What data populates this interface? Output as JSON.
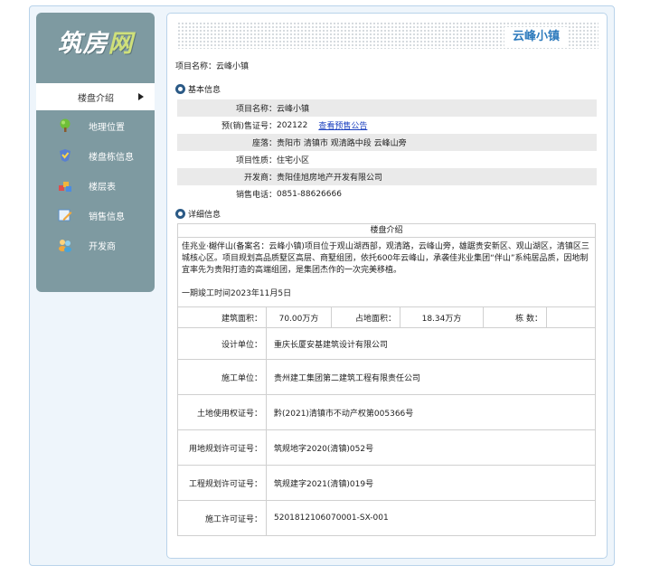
{
  "sidebar": {
    "logo": {
      "part1": "筑房",
      "part2": "网"
    },
    "active_item": "楼盘介绍",
    "items": [
      {
        "label": "地理位置",
        "icon": "tree-icon"
      },
      {
        "label": "楼盘栋信息",
        "icon": "badge-icon"
      },
      {
        "label": "楼层表",
        "icon": "blocks-icon"
      },
      {
        "label": "销售信息",
        "icon": "pencil-icon"
      },
      {
        "label": "开发商",
        "icon": "people-icon"
      }
    ]
  },
  "banner": {
    "title": "云峰小镇"
  },
  "project_name_line": "项目名称：云峰小镇",
  "basic": {
    "heading": "基本信息",
    "rows": [
      {
        "key": "项目名称：",
        "value": "云峰小镇"
      },
      {
        "key": "预(销)售证号：",
        "value": "202122",
        "link": "查看预售公告"
      },
      {
        "key": "座落：",
        "value": "贵阳市 清镇市 观清路中段 云峰山旁"
      },
      {
        "key": "项目性质：",
        "value": "住宅小区"
      },
      {
        "key": "开发商：",
        "value": "贵阳佳旭房地产开发有限公司"
      },
      {
        "key": "销售电话：",
        "value": "0851-88626666"
      }
    ]
  },
  "detail": {
    "heading": "详细信息",
    "table_title": "楼盘介绍",
    "description": "佳兆业·樾伴山(备案名：云峰小镇)项目位于观山湖西部，观清路，云峰山旁，雄踞贵安新区、观山湖区，清镇区三城核心区。项目规划高品质墅区高层、商墅组团，依托600年云峰山，承袭佳兆业集团“伴山”系纯居品质，因地制宜率先为贵阳打造的高端组团，是集团杰作的一次完美移植。",
    "completion": "一期竣工时间2023年11月5日",
    "area": {
      "build_label": "建筑面积：",
      "build_value": "70.00万方",
      "land_label": "占地面积：",
      "land_value": "18.34万方",
      "count_label": "栋 数：",
      "count_value": ""
    },
    "rows": [
      {
        "key": "设计单位：",
        "value": "重庆长厦安基建筑设计有限公司"
      },
      {
        "key": "施工单位：",
        "value": "贵州建工集团第二建筑工程有限责任公司"
      },
      {
        "key": "土地使用权证号：",
        "value": "黔(2021)清镇市不动产权第005366号"
      },
      {
        "key": "用地规划许可证号：",
        "value": "筑规地字2020(清镇)052号"
      },
      {
        "key": "工程规划许可证号：",
        "value": "筑规建字2021(清镇)019号"
      },
      {
        "key": "施工许可证号：",
        "value": "5201812106070001-SX-001"
      }
    ]
  }
}
